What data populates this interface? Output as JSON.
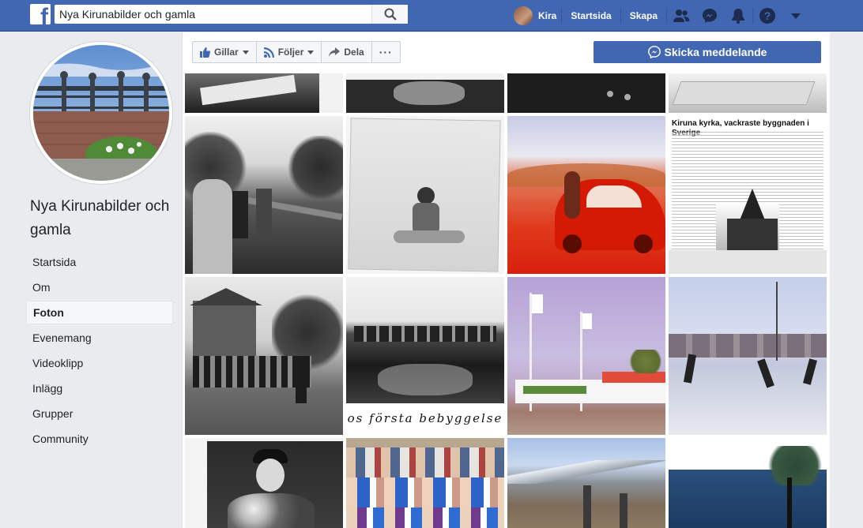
{
  "topbar": {
    "search_value": "Nya Kirunabilder och gamla",
    "search_placeholder": "Sök",
    "user_name": "Kira",
    "nav": [
      "Startsida",
      "Skapa"
    ]
  },
  "page": {
    "name": "Nya Kirunabilder och gamla"
  },
  "sidebar": {
    "items": [
      {
        "label": "Startsida",
        "active": false
      },
      {
        "label": "Om",
        "active": false
      },
      {
        "label": "Foton",
        "active": true
      },
      {
        "label": "Evenemang",
        "active": false
      },
      {
        "label": "Videoklipp",
        "active": false
      },
      {
        "label": "Inlägg",
        "active": false
      },
      {
        "label": "Grupper",
        "active": false
      },
      {
        "label": "Community",
        "active": false
      }
    ]
  },
  "actions": {
    "like_label": "Gillar",
    "follow_label": "Följer",
    "share_label": "Dela",
    "more_label": "···",
    "message_label": "Skicka meddelande"
  },
  "photos": {
    "caption_settlement": "os första bebyggelse",
    "article_title": "Kiruna kyrka, vackraste byggnaden i Sverige"
  },
  "colors": {
    "brand": "#4267b2",
    "background": "#e9ebee"
  }
}
